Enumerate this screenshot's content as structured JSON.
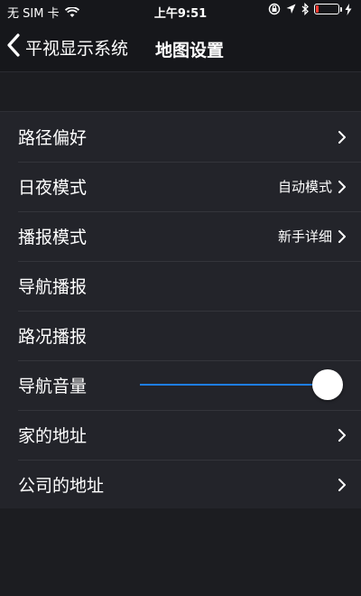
{
  "status_bar": {
    "carrier": "无 SIM 卡",
    "time": "上午9:51",
    "battery_level": 0.12
  },
  "nav": {
    "back_label": "平视显示系统",
    "title": "地图设置"
  },
  "settings": {
    "route_pref": {
      "label": "路径偏好"
    },
    "day_night": {
      "label": "日夜模式",
      "value": "自动模式"
    },
    "broadcast_mode": {
      "label": "播报模式",
      "value": "新手详细"
    },
    "nav_broadcast": {
      "label": "导航播报"
    },
    "traffic_broadcast": {
      "label": "路况播报"
    },
    "nav_volume": {
      "label": "导航音量",
      "level": 1.0
    },
    "home_address": {
      "label": "家的地址"
    },
    "company_address": {
      "label": "公司的地址"
    }
  },
  "colors": {
    "accent": "#1e7ee8",
    "battery_low": "#ff3b30"
  }
}
